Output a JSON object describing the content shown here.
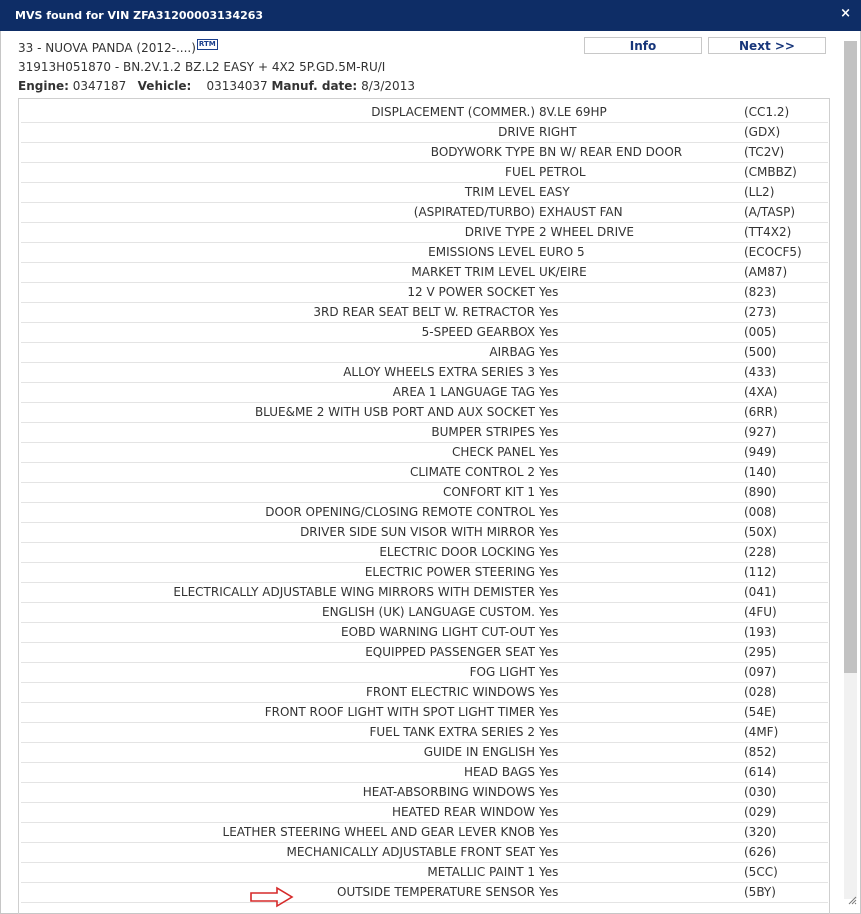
{
  "dialog": {
    "title": "MVS found for VIN ZFA31200003134263",
    "close_label": "×"
  },
  "header": {
    "model": "33 - NUOVA PANDA (2012-....)",
    "rtm_badge": "RTM",
    "variant": "31913H051870 - BN.2V.1.2 BZ.L2 EASY + 4X2 5P.GD.5M-RU/I",
    "engine_label": "Engine:",
    "engine_value": "0347187",
    "vehicle_label": "Vehicle:",
    "vehicle_value": "03134037",
    "manuf_label": "Manuf. date:",
    "manuf_value": "8/3/2013"
  },
  "buttons": {
    "info": "Info",
    "next": "Next >>"
  },
  "colors": {
    "titlebar": "#0e2d66",
    "button_text": "#16357a",
    "arrow": "#d62a2a"
  },
  "rows": [
    {
      "name": "DISPLACEMENT (COMMER.)",
      "value": "8V.LE 69HP",
      "code": "(CC1.2)"
    },
    {
      "name": "DRIVE",
      "value": "RIGHT",
      "code": "(GDX)"
    },
    {
      "name": "BODYWORK TYPE",
      "value": "BN W/ REAR END DOOR",
      "code": "(TC2V)"
    },
    {
      "name": "FUEL",
      "value": "PETROL",
      "code": "(CMBBZ)"
    },
    {
      "name": "TRIM LEVEL",
      "value": "EASY",
      "code": "(LL2)"
    },
    {
      "name": "(ASPIRATED/TURBO)",
      "value": "EXHAUST FAN",
      "code": "(A/TASP)"
    },
    {
      "name": "DRIVE TYPE",
      "value": "2 WHEEL DRIVE",
      "code": "(TT4X2)"
    },
    {
      "name": "EMISSIONS LEVEL",
      "value": "EURO 5",
      "code": "(ECOCF5)"
    },
    {
      "name": "MARKET TRIM LEVEL",
      "value": "UK/EIRE",
      "code": "(AM87)"
    },
    {
      "name": "12 V POWER SOCKET",
      "value": "Yes",
      "code": "(823)"
    },
    {
      "name": "3RD REAR SEAT BELT W. RETRACTOR",
      "value": "Yes",
      "code": "(273)"
    },
    {
      "name": "5-SPEED GEARBOX",
      "value": "Yes",
      "code": "(005)"
    },
    {
      "name": "AIRBAG",
      "value": "Yes",
      "code": "(500)"
    },
    {
      "name": "ALLOY WHEELS EXTRA SERIES 3",
      "value": "Yes",
      "code": "(433)"
    },
    {
      "name": "AREA 1 LANGUAGE TAG",
      "value": "Yes",
      "code": "(4XA)"
    },
    {
      "name": "BLUE&ME 2 WITH USB PORT AND AUX SOCKET",
      "value": "Yes",
      "code": "(6RR)"
    },
    {
      "name": "BUMPER STRIPES",
      "value": "Yes",
      "code": "(927)"
    },
    {
      "name": "CHECK PANEL",
      "value": "Yes",
      "code": "(949)"
    },
    {
      "name": "CLIMATE CONTROL 2",
      "value": "Yes",
      "code": "(140)"
    },
    {
      "name": "CONFORT KIT 1",
      "value": "Yes",
      "code": "(890)"
    },
    {
      "name": "DOOR OPENING/CLOSING REMOTE CONTROL",
      "value": "Yes",
      "code": "(008)"
    },
    {
      "name": "DRIVER SIDE SUN VISOR WITH MIRROR",
      "value": "Yes",
      "code": "(50X)"
    },
    {
      "name": "ELECTRIC DOOR LOCKING",
      "value": "Yes",
      "code": "(228)"
    },
    {
      "name": "ELECTRIC POWER STEERING",
      "value": "Yes",
      "code": "(112)"
    },
    {
      "name": "ELECTRICALLY ADJUSTABLE WING MIRRORS WITH DEMISTER",
      "value": "Yes",
      "code": "(041)"
    },
    {
      "name": "ENGLISH (UK) LANGUAGE CUSTOM.",
      "value": "Yes",
      "code": "(4FU)"
    },
    {
      "name": "EOBD WARNING LIGHT CUT-OUT",
      "value": "Yes",
      "code": "(193)"
    },
    {
      "name": "EQUIPPED PASSENGER SEAT",
      "value": "Yes",
      "code": "(295)"
    },
    {
      "name": "FOG LIGHT",
      "value": "Yes",
      "code": "(097)"
    },
    {
      "name": "FRONT ELECTRIC WINDOWS",
      "value": "Yes",
      "code": "(028)"
    },
    {
      "name": "FRONT ROOF LIGHT WITH SPOT LIGHT TIMER",
      "value": "Yes",
      "code": "(54E)"
    },
    {
      "name": "FUEL TANK EXTRA SERIES 2",
      "value": "Yes",
      "code": "(4MF)"
    },
    {
      "name": "GUIDE IN ENGLISH",
      "value": "Yes",
      "code": "(852)"
    },
    {
      "name": "HEAD BAGS",
      "value": "Yes",
      "code": "(614)"
    },
    {
      "name": "HEAT-ABSORBING WINDOWS",
      "value": "Yes",
      "code": "(030)"
    },
    {
      "name": "HEATED REAR WINDOW",
      "value": "Yes",
      "code": "(029)"
    },
    {
      "name": "LEATHER STEERING WHEEL AND GEAR LEVER KNOB",
      "value": "Yes",
      "code": "(320)"
    },
    {
      "name": "MECHANICALLY ADJUSTABLE FRONT SEAT",
      "value": "Yes",
      "code": "(626)"
    },
    {
      "name": "METALLIC PAINT 1",
      "value": "Yes",
      "code": "(5CC)"
    },
    {
      "name": "OUTSIDE TEMPERATURE SENSOR",
      "value": "Yes",
      "code": "(5BY)"
    }
  ]
}
